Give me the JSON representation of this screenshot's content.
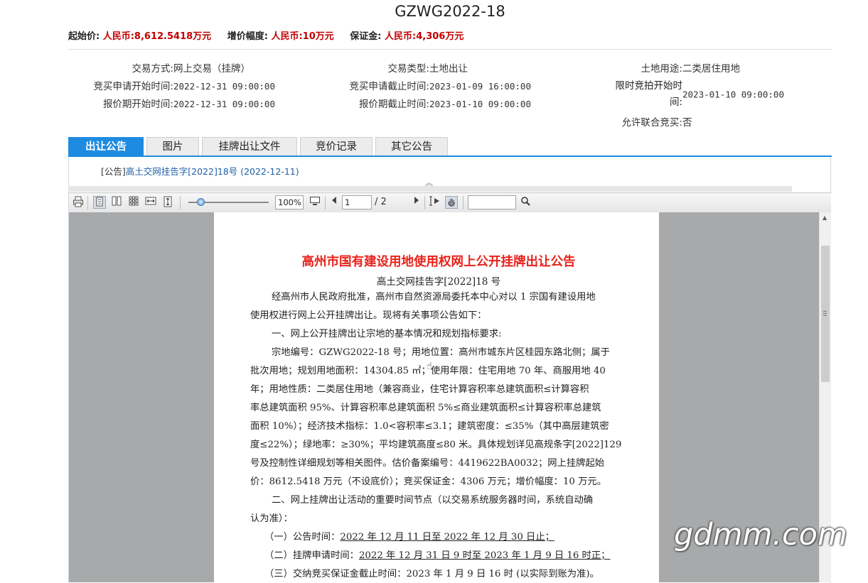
{
  "header": {
    "title": "GZWG2022-18",
    "start_price_label": "起始价:",
    "start_price_value": "人民币:8,612.5418万元",
    "increment_label": "增价幅度:",
    "increment_value": "人民币:10万元",
    "deposit_label": "保证金:",
    "deposit_value": "人民币:4,306万元"
  },
  "info": {
    "trade_method_label": "交易方式:",
    "trade_method_value": "网上交易（挂牌）",
    "trade_type_label": "交易类型:",
    "trade_type_value": "土地出让",
    "land_use_label": "土地用途:",
    "land_use_value": "二类居住用地",
    "apply_start_label": "竞买申请开始时间:",
    "apply_start_value": "2022-12-31 09:00:00",
    "apply_end_label": "竞买申请截止时间:",
    "apply_end_value": "2023-01-09 16:00:00",
    "timed_bid_label_1": "限时竞拍开始时",
    "timed_bid_label_2": "间:",
    "timed_bid_value": "2023-01-10 09:00:00",
    "quote_start_label": "报价期开始时间:",
    "quote_start_value": "2022-12-31 09:00:00",
    "quote_end_label": "报价期截止时间:",
    "quote_end_value": "2023-01-10 09:00:00",
    "joint_bid_label": "允许联合竞买:",
    "joint_bid_value": "否"
  },
  "tabs": [
    {
      "label": "出让公告"
    },
    {
      "label": "图片"
    },
    {
      "label": "挂牌出让文件"
    },
    {
      "label": "竞价记录"
    },
    {
      "label": "其它公告"
    }
  ],
  "notice": {
    "prefix": "[公告]",
    "link": "高土交网挂告字[2022]18号 (2022-12-11)"
  },
  "toolbar": {
    "zoom": "100%",
    "page_current": "1",
    "page_total": "/ 2",
    "search_value": ""
  },
  "document": {
    "title": "高州市国有建设用地使用权网上公开挂牌出让公告",
    "subtitle": "高土交网挂告字[2022]18 号",
    "lines": [
      "经高州市人民政府批准，高州市自然资源局委托本中心对以 1 宗国有建设用地",
      "使用权进行网上公开挂牌出让。现将有关事项公告如下：",
      "一、网上公开挂牌出让宗地的基本情况和规划指标要求:",
      "宗地编号：GZWG2022-18 号；用地位置：高州市城东片区桂园东路北侧；属于",
      "批次用地；规划用地面积：14304.85 ㎡；使用年限：住宅用地 70 年、商服用地 40",
      "年；用地性质：二类居住用地（兼容商业，住宅计算容积率总建筑面积≤计算容积",
      "率总建筑面积 95%、计算容积率总建筑面积 5%≤商业建筑面积≤计算容积率总建筑",
      "面积 10%）；经济技术指标：1.0<容积率≤3.1；建筑密度：≤35%（其中高层建筑密",
      "度≤22%）；绿地率：≥30%；平均建筑高度≤80 米。具体规划详见高规条字[2022]129",
      "号及控制性详细规划等相关图件。估价备案编号：4419622BA0032；网上挂牌起始",
      "价：8612.5418 万元（不设底价）；竞买保证金：4306 万元；增价幅度：10 万元。",
      "二、网上挂牌出让活动的重要时间节点（以交易系统服务器时间，系统自动确",
      "认为准）："
    ],
    "time_1_prefix": "（一）公告时间：",
    "time_1_value": "2022 年 12 月 11 日至 2022 年 12 月 30 日止；",
    "time_2_prefix": "（二）挂牌申请时间：",
    "time_2_value": "2022 年 12 月 31 日 9 时至 2023 年 1 月 9 日 16 时正；",
    "time_3": "（三）交纳竞买保证金截止时间：2023 年 1 月 9 日 16 时 (以实际到账为准)。"
  },
  "watermark": "gdmm.com",
  "colors": {
    "accent": "#1d8be0",
    "price_red": "#c00000",
    "doc_title_red": "#e8221b",
    "link_blue": "#1f5fa6"
  }
}
